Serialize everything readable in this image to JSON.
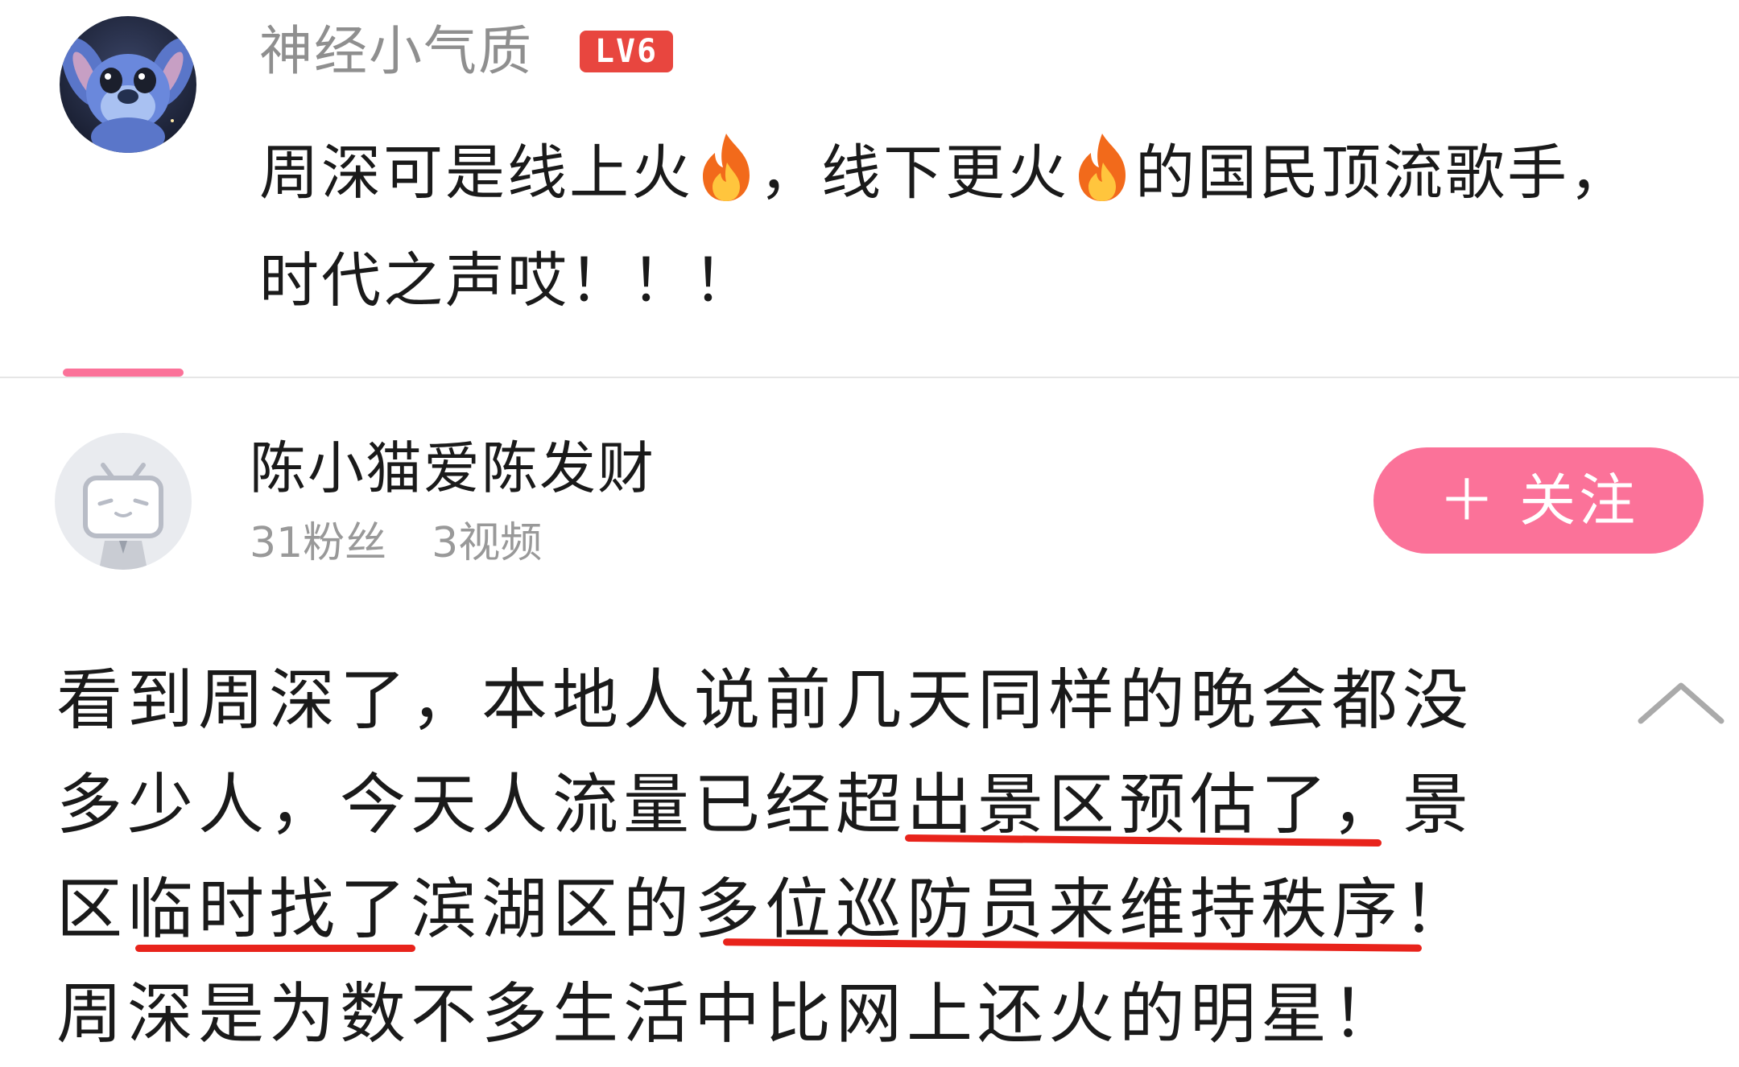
{
  "comment": {
    "username": "神经小气质",
    "level_badge": "LV6",
    "text_part1": "周深可是线上火",
    "text_part2": "，线下更火",
    "text_part3": "的国民顶流歌手，时代之声哎！！！"
  },
  "user_card": {
    "username": "陈小猫爱陈发财",
    "fans": "31粉丝",
    "videos": "3视频",
    "follow_label": "＋ 关注"
  },
  "post": {
    "line1": "看到周深了，本地人说前几天同样的晚会都没",
    "line2": "多少人，今天人流量已经超出景区预估了，景",
    "line3": "区临时找了滨湖区的多位巡防员来维持秩序！",
    "line4": "周深是为数不多生活中比网上还火的明星！"
  },
  "colors": {
    "accent_pink": "#fb7299",
    "badge_red": "#e8463f",
    "underline_red": "#e8231b",
    "muted_gray": "#999999"
  },
  "icons": [
    "fire-icon",
    "chevron-up-icon",
    "plus-icon"
  ]
}
